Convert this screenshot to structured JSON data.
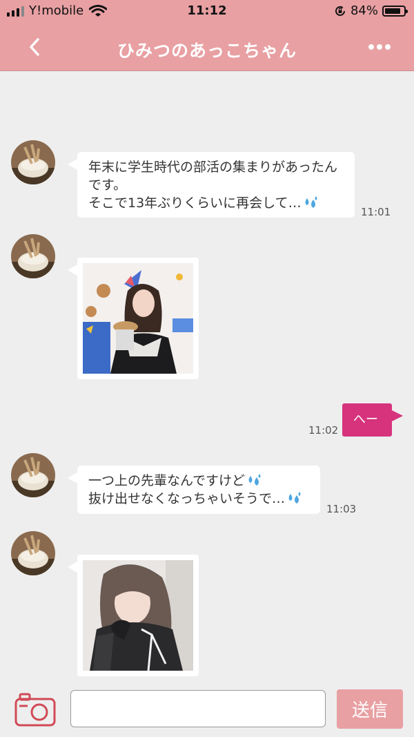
{
  "status": {
    "carrier": "Y!mobile",
    "time": "11:12",
    "battery": "84%",
    "battery_level": 0.84
  },
  "header": {
    "title": "ひみつのあっこちゃん",
    "back_icon": "chevron-left-icon",
    "more_icon": "ellipsis-icon"
  },
  "messages": [
    {
      "type": "text",
      "direction": "in",
      "text": "年末に学生時代の部活の集まりがあったんです。そこで13年ぶりくらいに再会して…",
      "lines": [
        "年末に学生時代の部活の集まりがあったん",
        "です。",
        "そこで13年ぶりくらいに再会して…"
      ],
      "time": "11:01"
    },
    {
      "type": "image",
      "direction": "in"
    },
    {
      "type": "text",
      "direction": "out",
      "text": "へー",
      "time": "11:02"
    },
    {
      "type": "text",
      "direction": "in",
      "lines": [
        "一つ上の先輩なんですけど",
        "抜け出せなくなっちゃいそうで…"
      ],
      "time": "11:03"
    },
    {
      "type": "image",
      "direction": "in"
    }
  ],
  "composer": {
    "camera_icon": "camera-icon",
    "input_value": "",
    "input_placeholder": "",
    "send_label": "送信"
  },
  "colors": {
    "header": "#e8a0a3",
    "outgoing_bubble": "#d6337c",
    "background": "#eeeeee",
    "send_button": "#e8a0a3"
  }
}
